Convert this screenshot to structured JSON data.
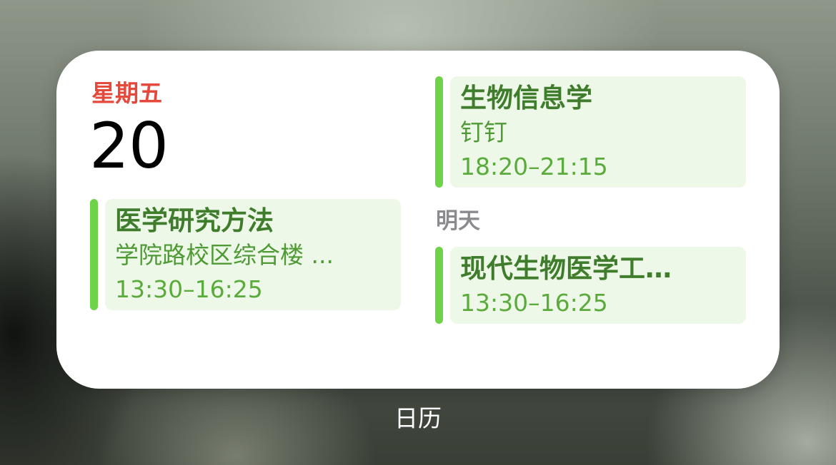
{
  "app_name": "日历",
  "today": {
    "weekday": "星期五",
    "day": "20"
  },
  "events_today": [
    {
      "title": "医学研究方法",
      "location": "学院路校区综合楼 ...",
      "time": "13:30–16:25"
    },
    {
      "title": "生物信息学",
      "location": "钉钉",
      "time": "18:20–21:15"
    }
  ],
  "tomorrow": {
    "label": "明天",
    "events": [
      {
        "title": "现代生物医学工…",
        "time": "13:30–16:25"
      }
    ]
  },
  "colors": {
    "weekday": "#e5493b",
    "event_bar": "#6fd34a",
    "event_bg": "#eef8e9",
    "event_title": "#3f7d2c",
    "event_time": "#5aab3b",
    "tomorrow_label": "#8b8b8f"
  }
}
